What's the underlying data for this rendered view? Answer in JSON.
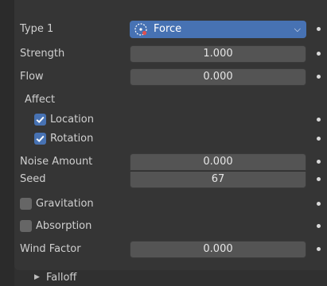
{
  "rows": {
    "type": {
      "label": "Type 1",
      "value": "Force",
      "icon": "force-field-icon"
    },
    "strength": {
      "label": "Strength",
      "value": "1.000"
    },
    "flow": {
      "label": "Flow",
      "value": "0.000"
    },
    "affect": {
      "label": "Affect"
    },
    "location": {
      "label": "Location",
      "checked": true
    },
    "rotation": {
      "label": "Rotation",
      "checked": true
    },
    "noise_amount": {
      "label": "Noise Amount",
      "value": "0.000"
    },
    "seed": {
      "label": "Seed",
      "value": "67"
    },
    "gravitation": {
      "label": "Gravitation",
      "checked": false
    },
    "absorption": {
      "label": "Absorption",
      "checked": false
    },
    "wind_factor": {
      "label": "Wind Factor",
      "value": "0.000"
    }
  },
  "falloff": {
    "label": "Falloff",
    "expanded": false
  },
  "colors": {
    "accent": "#4772b3",
    "field": "#545454",
    "panel": "#353535",
    "background": "#2b2b2b"
  }
}
